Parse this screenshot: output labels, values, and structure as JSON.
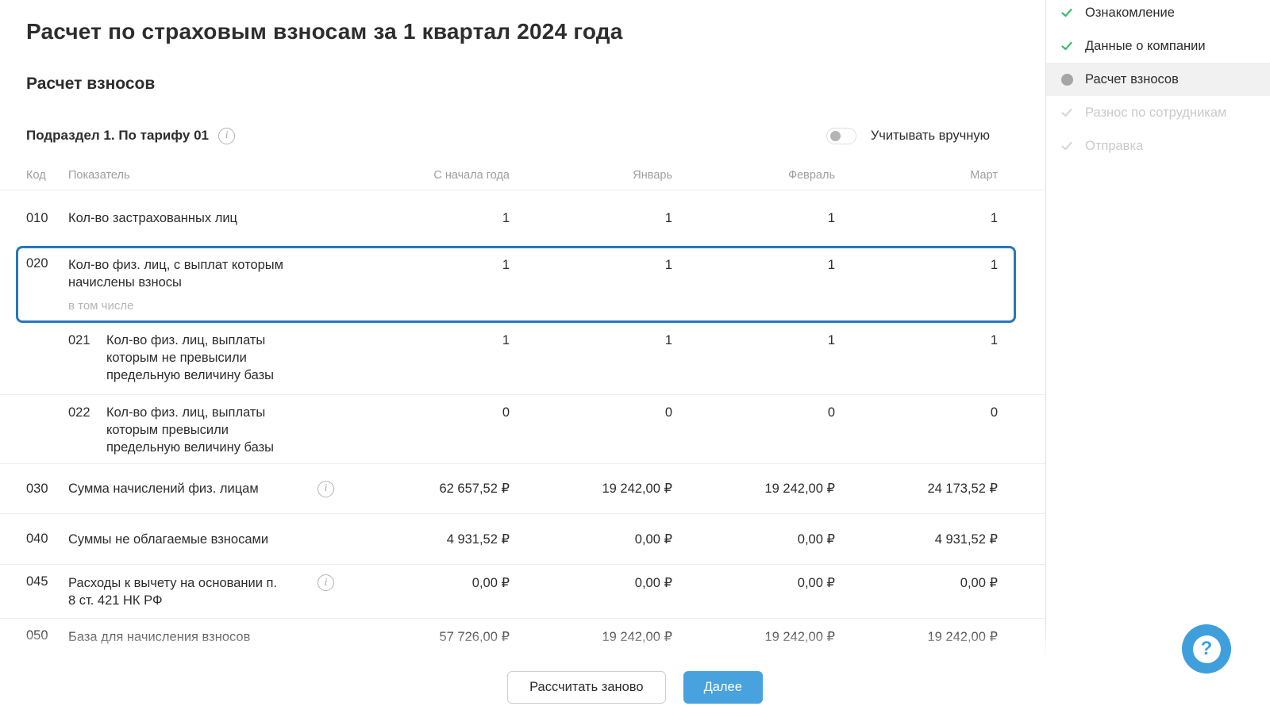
{
  "page": {
    "title": "Расчет по страховым взносам за 1 квартал 2024 года",
    "section_title": "Расчет взносов",
    "subsection_title": "Подраздел 1. По тарифу 01",
    "toggle_label": "Учитывать вручную",
    "toggle_state": "off"
  },
  "table": {
    "headers": {
      "code": "Код",
      "indicator": "Показатель",
      "ytd": "С начала года",
      "jan": "Январь",
      "feb": "Февраль",
      "mar": "Март"
    },
    "rows": [
      {
        "code": "010",
        "label": "Кол-во застрахованных лиц",
        "values": [
          "1",
          "1",
          "1",
          "1"
        ]
      },
      {
        "code": "020",
        "label": "Кол-во физ. лиц, с выплат которым начислены взносы",
        "note": "в том числе",
        "highlighted": true,
        "values": [
          "1",
          "1",
          "1",
          "1"
        ]
      },
      {
        "code": "021",
        "label": "Кол-во физ. лиц, выплаты которым не превысили предельную величину базы",
        "sub_row": true,
        "values": [
          "1",
          "1",
          "1",
          "1"
        ]
      },
      {
        "code": "022",
        "label": "Кол-во физ. лиц, выплаты которым превысили предельную величину базы",
        "sub_row": true,
        "values": [
          "0",
          "0",
          "0",
          "0"
        ]
      },
      {
        "code": "030",
        "label": "Сумма начислений физ. лицам",
        "has_info": true,
        "values": [
          "62 657,52 ₽",
          "19 242,00 ₽",
          "19 242,00 ₽",
          "24 173,52 ₽"
        ]
      },
      {
        "code": "040",
        "label": "Суммы не облагаемые взносами",
        "values": [
          "4 931,52 ₽",
          "0,00 ₽",
          "0,00 ₽",
          "4 931,52 ₽"
        ]
      },
      {
        "code": "045",
        "label": "Расходы к вычету на основании п. 8 ст. 421 НК РФ",
        "has_info": true,
        "values": [
          "0,00 ₽",
          "0,00 ₽",
          "0,00 ₽",
          "0,00 ₽"
        ]
      },
      {
        "code": "050",
        "label": "База для начисления взносов",
        "values": [
          "57 726,00 ₽",
          "19 242,00 ₽",
          "19 242,00 ₽",
          "19 242,00 ₽"
        ]
      }
    ]
  },
  "steps": [
    {
      "label": "Ознакомление",
      "state": "done"
    },
    {
      "label": "Данные о компании",
      "state": "done"
    },
    {
      "label": "Расчет взносов",
      "state": "active"
    },
    {
      "label": "Разнос по сотрудникам",
      "state": "pending"
    },
    {
      "label": "Отправка",
      "state": "pending"
    }
  ],
  "footer": {
    "recalculate_label": "Рассчитать заново",
    "next_label": "Далее"
  },
  "help": {
    "icon": "?"
  },
  "icons": {
    "info": "i"
  },
  "colors": {
    "highlight_border": "#2778bc",
    "primary_button": "#47a2de",
    "help_button": "#3f9fdb",
    "success_green": "#3cba72",
    "disabled_gray": "#cacaca",
    "active_step_bg": "#f1f1f1"
  }
}
